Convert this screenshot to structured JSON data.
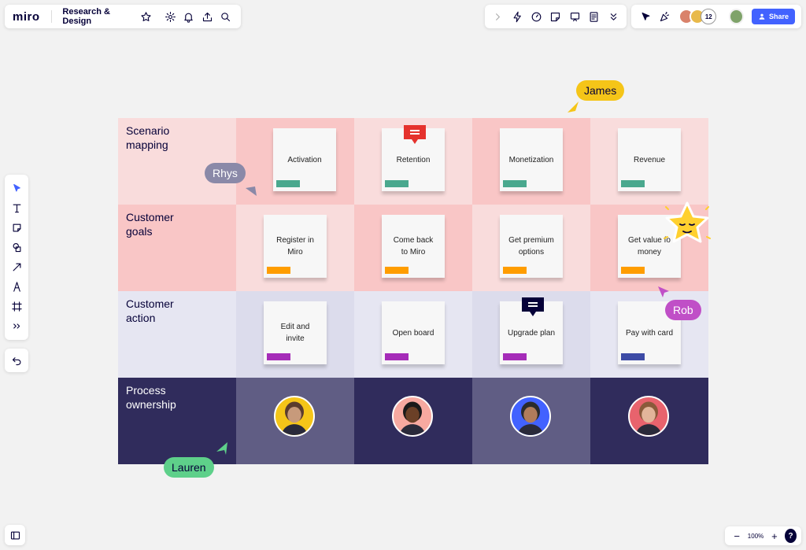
{
  "app": {
    "logo": "miro",
    "board_title": "Research & Design"
  },
  "topbar": {
    "participant_count": "12",
    "share_label": "Share"
  },
  "zoom": {
    "level": "100%",
    "minus": "−",
    "plus": "+",
    "help": "?"
  },
  "rows": [
    {
      "label": "Scenario\nmapping",
      "bg": [
        "#f9dcdc",
        "#f9c6c6",
        "#f9dcdc",
        "#f9c6c6",
        "#f9dcdc"
      ],
      "text_color": "dark"
    },
    {
      "label": "Customer\ngoals",
      "bg": [
        "#f9c6c6",
        "#f9dcdc",
        "#f9c6c6",
        "#f9dcdc",
        "#f9c6c6"
      ],
      "text_color": "dark"
    },
    {
      "label": "Customer\naction",
      "bg": [
        "#e6e6f2",
        "#dcdcec",
        "#e6e6f2",
        "#dcdcec",
        "#e6e6f2"
      ],
      "text_color": "dark"
    },
    {
      "label": "Process\nownership",
      "bg": [
        "#302c5c",
        "#605d84",
        "#302c5c",
        "#605d84",
        "#302c5c"
      ],
      "text_color": "light"
    }
  ],
  "stickies": [
    {
      "text": "Activation",
      "tag_color": "#4aa88e"
    },
    {
      "text": "Retention",
      "tag_color": "#4aa88e"
    },
    {
      "text": "Monetization",
      "tag_color": "#4aa88e"
    },
    {
      "text": "Revenue",
      "tag_color": "#4aa88e"
    },
    {
      "text": "Register in\nMiro",
      "tag_color": "#ff9d00"
    },
    {
      "text": "Come back\nto Miro",
      "tag_color": "#ff9d00"
    },
    {
      "text": "Get premium\noptions",
      "tag_color": "#ff9d00"
    },
    {
      "text": "Get value fo\nmoney",
      "tag_color": "#ff9d00"
    },
    {
      "text": "Edit and\ninvite",
      "tag_color": "#a52cb8"
    },
    {
      "text": "Open board",
      "tag_color": "#a52cb8"
    },
    {
      "text": "Upgrade plan",
      "tag_color": "#a52cb8"
    },
    {
      "text": "Pay with card",
      "tag_color": "#3d4ba6"
    }
  ],
  "owners": [
    {
      "ring": "#f5c518"
    },
    {
      "ring": "#f7a9a0"
    },
    {
      "ring": "#4262ff"
    },
    {
      "ring": "#e8636d"
    }
  ],
  "cursors": [
    {
      "name": "James",
      "color": "#f5c518",
      "text": "#050038"
    },
    {
      "name": "Rhys",
      "color": "#8a89a8",
      "text": "#ffffff"
    },
    {
      "name": "Rob",
      "color": "#c04fc7",
      "text": "#ffffff"
    },
    {
      "name": "Lauren",
      "color": "#5ed08a",
      "text": "#050038"
    }
  ],
  "icons": {
    "top_left": [
      "star-icon",
      "gear-icon",
      "bell-icon",
      "upload-icon",
      "search-icon"
    ],
    "top_mid": [
      "chevron-right-icon",
      "lightning-icon",
      "timer-icon",
      "sticker-icon",
      "present-icon",
      "notes-icon",
      "chevron-double-down-icon"
    ],
    "left_toolbar": [
      "select-cursor-icon",
      "text-icon",
      "sticky-note-icon",
      "shapes-icon",
      "arrow-line-icon",
      "pen-icon",
      "frame-icon",
      "more-tools-icon"
    ]
  }
}
